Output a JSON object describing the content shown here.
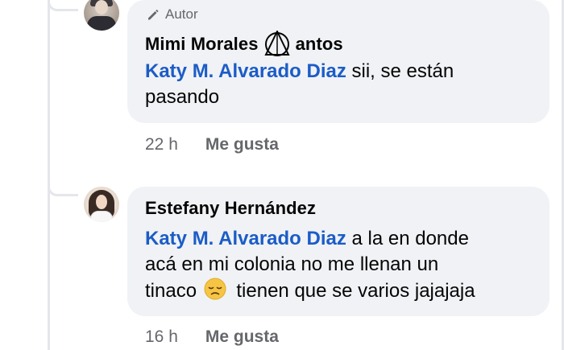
{
  "comments": [
    {
      "badge": "Autor",
      "name_prefix": "Mimi Morales",
      "name_suffix": "antos",
      "mention": "Katy M. Alvarado Diaz",
      "text_line1_rest": " sii, se están",
      "text_line2": "pasando",
      "time": "22 h",
      "like_label": "Me gusta"
    },
    {
      "name": "Estefany Hernández",
      "mention": "Katy M. Alvarado Diaz",
      "text_line1_rest": " a la en donde",
      "text_line2": "acá en mi colonia no me llenan un",
      "text_line3_before": "tinaco",
      "text_line3_after": "tienen que se varios jajajaja",
      "time": "16 h",
      "like_label": "Me gusta"
    }
  ],
  "icons": {
    "badge": "pencil-icon",
    "name_symbol": "triangle-circle-symbol-icon",
    "emoji": "disappointed-face-icon"
  },
  "colors": {
    "mention": "#1b5cc7",
    "bubble": "#f0f2f5",
    "meta": "#65676b",
    "emoji": "#f6c544"
  }
}
